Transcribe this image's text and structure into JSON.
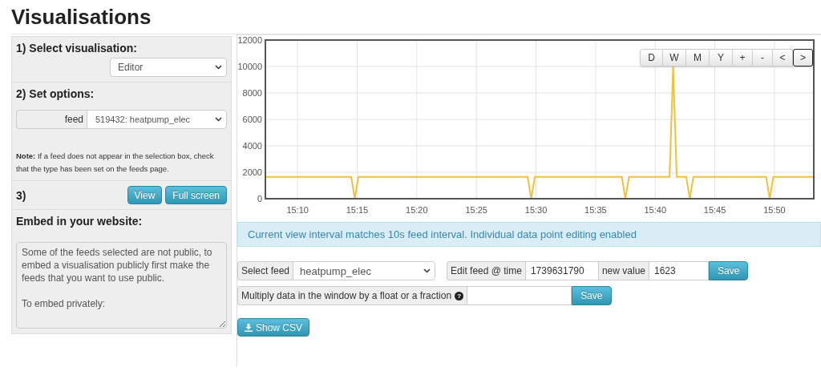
{
  "title": "Visualisations",
  "sidebar": {
    "step1": {
      "heading": "1) Select visualisation:",
      "select": "Editor"
    },
    "step2": {
      "heading": "2) Set options:",
      "addon": "feed",
      "select": "519432: heatpump_elec",
      "note": "**Note:** If a feed does not appear in the selection box, check that the type has been set on the feeds page."
    },
    "step3": {
      "heading": "3)",
      "buttons": [
        "View",
        "Full screen"
      ]
    },
    "embed": {
      "heading": "Embed in your website:",
      "text": "Some of the feeds selected are not public, to embed a visualisation publicly first make the feeds that you want to use public.\n\nTo embed privately:"
    }
  },
  "chart": {
    "buttons": [
      {
        "label": "D",
        "selected": false
      },
      {
        "label": "W",
        "selected": false
      },
      {
        "label": "M",
        "selected": false
      },
      {
        "label": "Y",
        "selected": false
      },
      {
        "label": "+",
        "selected": false
      },
      {
        "label": "-",
        "selected": false
      },
      {
        "label": "<",
        "selected": false
      },
      {
        "label": ">",
        "selected": true
      }
    ],
    "chart_data": {
      "type": "line",
      "grid": true,
      "xlim": [
        15.1217,
        15.8883
      ],
      "ylim": [
        0,
        12000
      ],
      "yticks": [
        0,
        2000,
        4000,
        6000,
        8000,
        10000,
        12000
      ],
      "xticks": [
        {
          "value": 15.1667,
          "label": "15:10"
        },
        {
          "value": 15.25,
          "label": "15:15"
        },
        {
          "value": 15.3333,
          "label": "15:20"
        },
        {
          "value": 15.4167,
          "label": "15:25"
        },
        {
          "value": 15.5,
          "label": "15:30"
        },
        {
          "value": 15.5833,
          "label": "15:35"
        },
        {
          "value": 15.6667,
          "label": "15:40"
        },
        {
          "value": 15.75,
          "label": "15:45"
        },
        {
          "value": 15.8333,
          "label": "15:50"
        }
      ],
      "x": [
        15.1217,
        15.2417,
        15.2467,
        15.2517,
        15.4883,
        15.4933,
        15.4983,
        15.62,
        15.625,
        15.63,
        15.6867,
        15.6917,
        15.6967,
        15.71,
        15.715,
        15.72,
        15.8217,
        15.8267,
        15.8317,
        15.8883
      ],
      "series": [
        {
          "color": "#edc240",
          "values": [
            1650,
            1650,
            0,
            1650,
            1650,
            0,
            1650,
            1650,
            0,
            1650,
            1650,
            10000,
            1650,
            1650,
            0,
            1650,
            1650,
            0,
            1650,
            1650
          ]
        }
      ]
    }
  },
  "alert": "Current view interval matches 10s feed interval. Individual data point editing enabled",
  "editor": {
    "select_label": "Select feed",
    "select_value": "heatpump_elec",
    "time_label": "Edit feed @ time",
    "time_value": "1739631790",
    "value_label": "new value",
    "value_value": "1623",
    "save": "Save",
    "multiply_label": "Multiply data in the window by a float or a fraction",
    "multiply_help": "?",
    "multiply_save": "Save"
  },
  "csv_button": "Show CSV"
}
